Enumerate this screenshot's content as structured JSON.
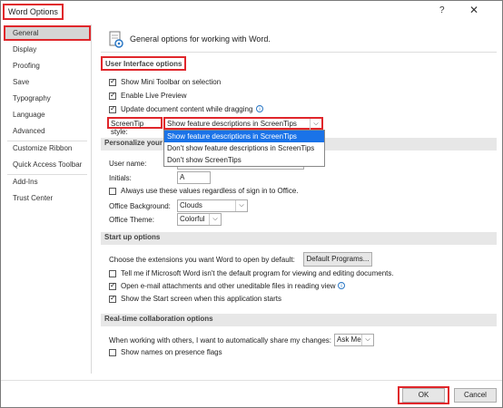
{
  "window": {
    "title": "Word Options",
    "help_glyph": "?",
    "close_glyph": "✕"
  },
  "sidebar": {
    "items": [
      {
        "label": "General"
      },
      {
        "label": "Display"
      },
      {
        "label": "Proofing"
      },
      {
        "label": "Save"
      },
      {
        "label": "Typography"
      },
      {
        "label": "Language"
      },
      {
        "label": "Advanced"
      },
      {
        "label": "Customize Ribbon"
      },
      {
        "label": "Quick Access Toolbar"
      },
      {
        "label": "Add-Ins"
      },
      {
        "label": "Trust Center"
      }
    ],
    "selected": "General"
  },
  "header": {
    "text": "General options for working with Word.",
    "icon": "settings-document-icon"
  },
  "ui_options": {
    "title": "User Interface options",
    "show_mini_toolbar": "Show Mini Toolbar on selection",
    "enable_live_preview": "Enable Live Preview",
    "update_content_dragging": "Update document content while dragging",
    "screentip_label": "ScreenTip style:",
    "screentip_value": "Show feature descriptions in ScreenTips",
    "screentip_options": [
      "Show feature descriptions in ScreenTips",
      "Don't show feature descriptions in ScreenTips",
      "Don't show ScreenTips"
    ]
  },
  "personalize": {
    "title": "Personalize your c",
    "user_name_label": "User name:",
    "initials_label": "Initials:",
    "initials_value": "A",
    "always_use": "Always use these values regardless of sign in to Office.",
    "office_background_label": "Office Background:",
    "office_background_value": "Clouds",
    "office_theme_label": "Office Theme:",
    "office_theme_value": "Colorful"
  },
  "startup": {
    "title": "Start up options",
    "choose_extensions": "Choose the extensions you want Word to open by default:",
    "default_programs_button": "Default Programs...",
    "tell_me": "Tell me if Microsoft Word isn't the default program for viewing and editing documents.",
    "open_email": "Open e-mail attachments and other uneditable files in reading view",
    "show_start": "Show the Start screen when this application starts"
  },
  "collab": {
    "title": "Real-time collaboration options",
    "share_changes": "When working with others, I want to automatically share my changes:",
    "share_value": "Ask Me",
    "show_names": "Show names on presence flags"
  },
  "footer": {
    "ok": "OK",
    "cancel": "Cancel"
  },
  "colors": {
    "highlight": "#e0262b",
    "dropdown_selected": "#1a73e8"
  }
}
